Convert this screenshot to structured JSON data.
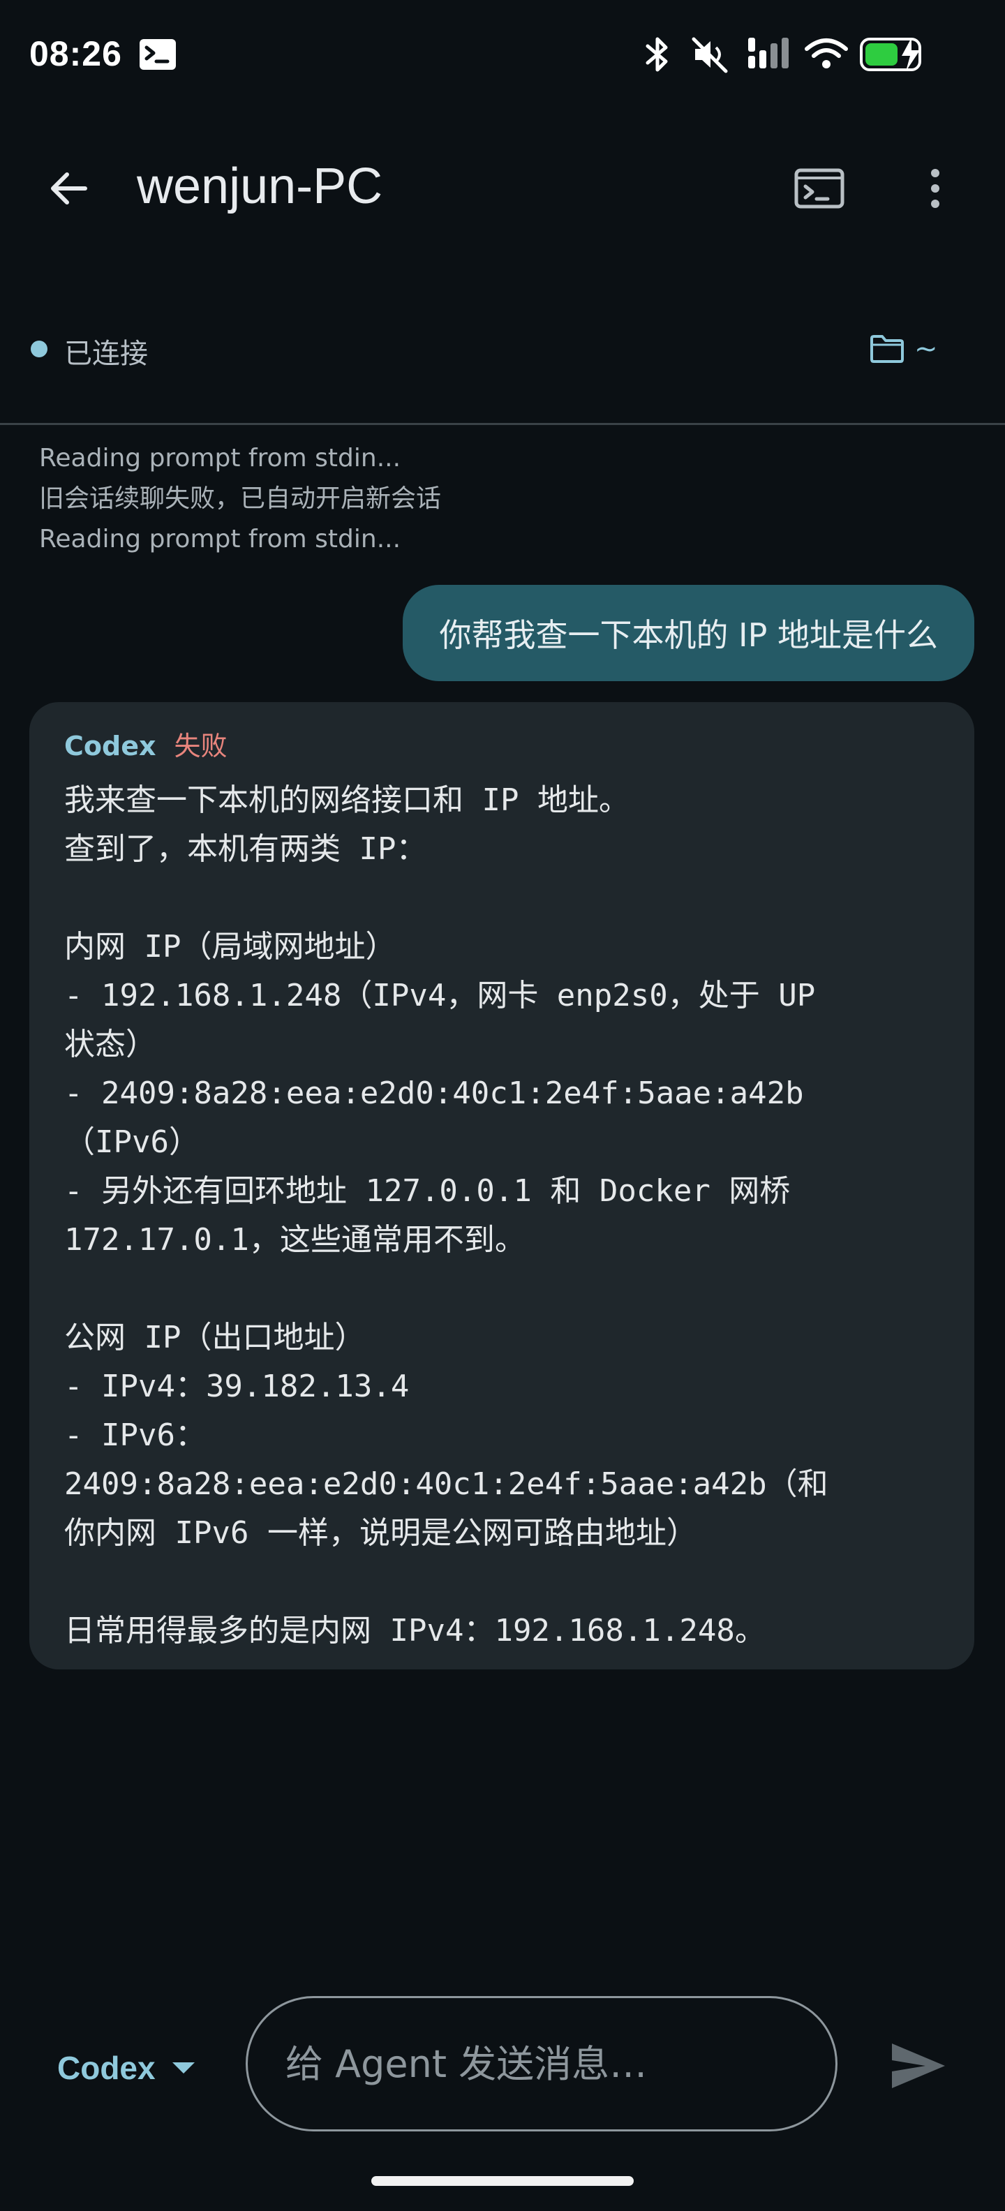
{
  "status_bar": {
    "time": "08:26",
    "battery_color": "#2ecc40"
  },
  "header": {
    "title": "wenjun-PC"
  },
  "connection": {
    "status": "已连接",
    "path": "~",
    "status_color": "#8fc9dc"
  },
  "log": [
    "Reading prompt from stdin...",
    "旧会话续聊失败，已自动开启新会话",
    "Reading prompt from stdin..."
  ],
  "user_message": "你帮我查一下本机的 IP 地址是什么",
  "agent_message": {
    "agent": "Codex",
    "status": "失败",
    "lines": [
      "我来查一下本机的网络接口和 IP 地址。",
      "查到了，本机有两类 IP：",
      "",
      "内网 IP（局域网地址）",
      "- 192.168.1.248（IPv4，网卡 enp2s0，处于 UP",
      "状态）",
      "- 2409:8a28:eea:e2d0:40c1:2e4f:5aae:a42b",
      "（IPv6）",
      "- 另外还有回环地址 127.0.0.1 和 Docker 网桥",
      "172.17.0.1，这些通常用不到。",
      "",
      "公网 IP（出口地址）",
      "- IPv4：39.182.13.4",
      "- IPv6：",
      "2409:8a28:eea:e2d0:40c1:2e4f:5aae:a42b（和",
      "你内网 IPv6 一样，说明是公网可路由地址）",
      "",
      "日常用得最多的是内网 IPv4：192.168.1.248。"
    ]
  },
  "composer": {
    "agent_label": "Codex",
    "placeholder": "给 Agent 发送消息…"
  },
  "colors": {
    "background": "#0b1014",
    "accent": "#8fc9dc",
    "user_bubble": "#255a66",
    "card": "#1f272c",
    "error": "#e8857d"
  }
}
